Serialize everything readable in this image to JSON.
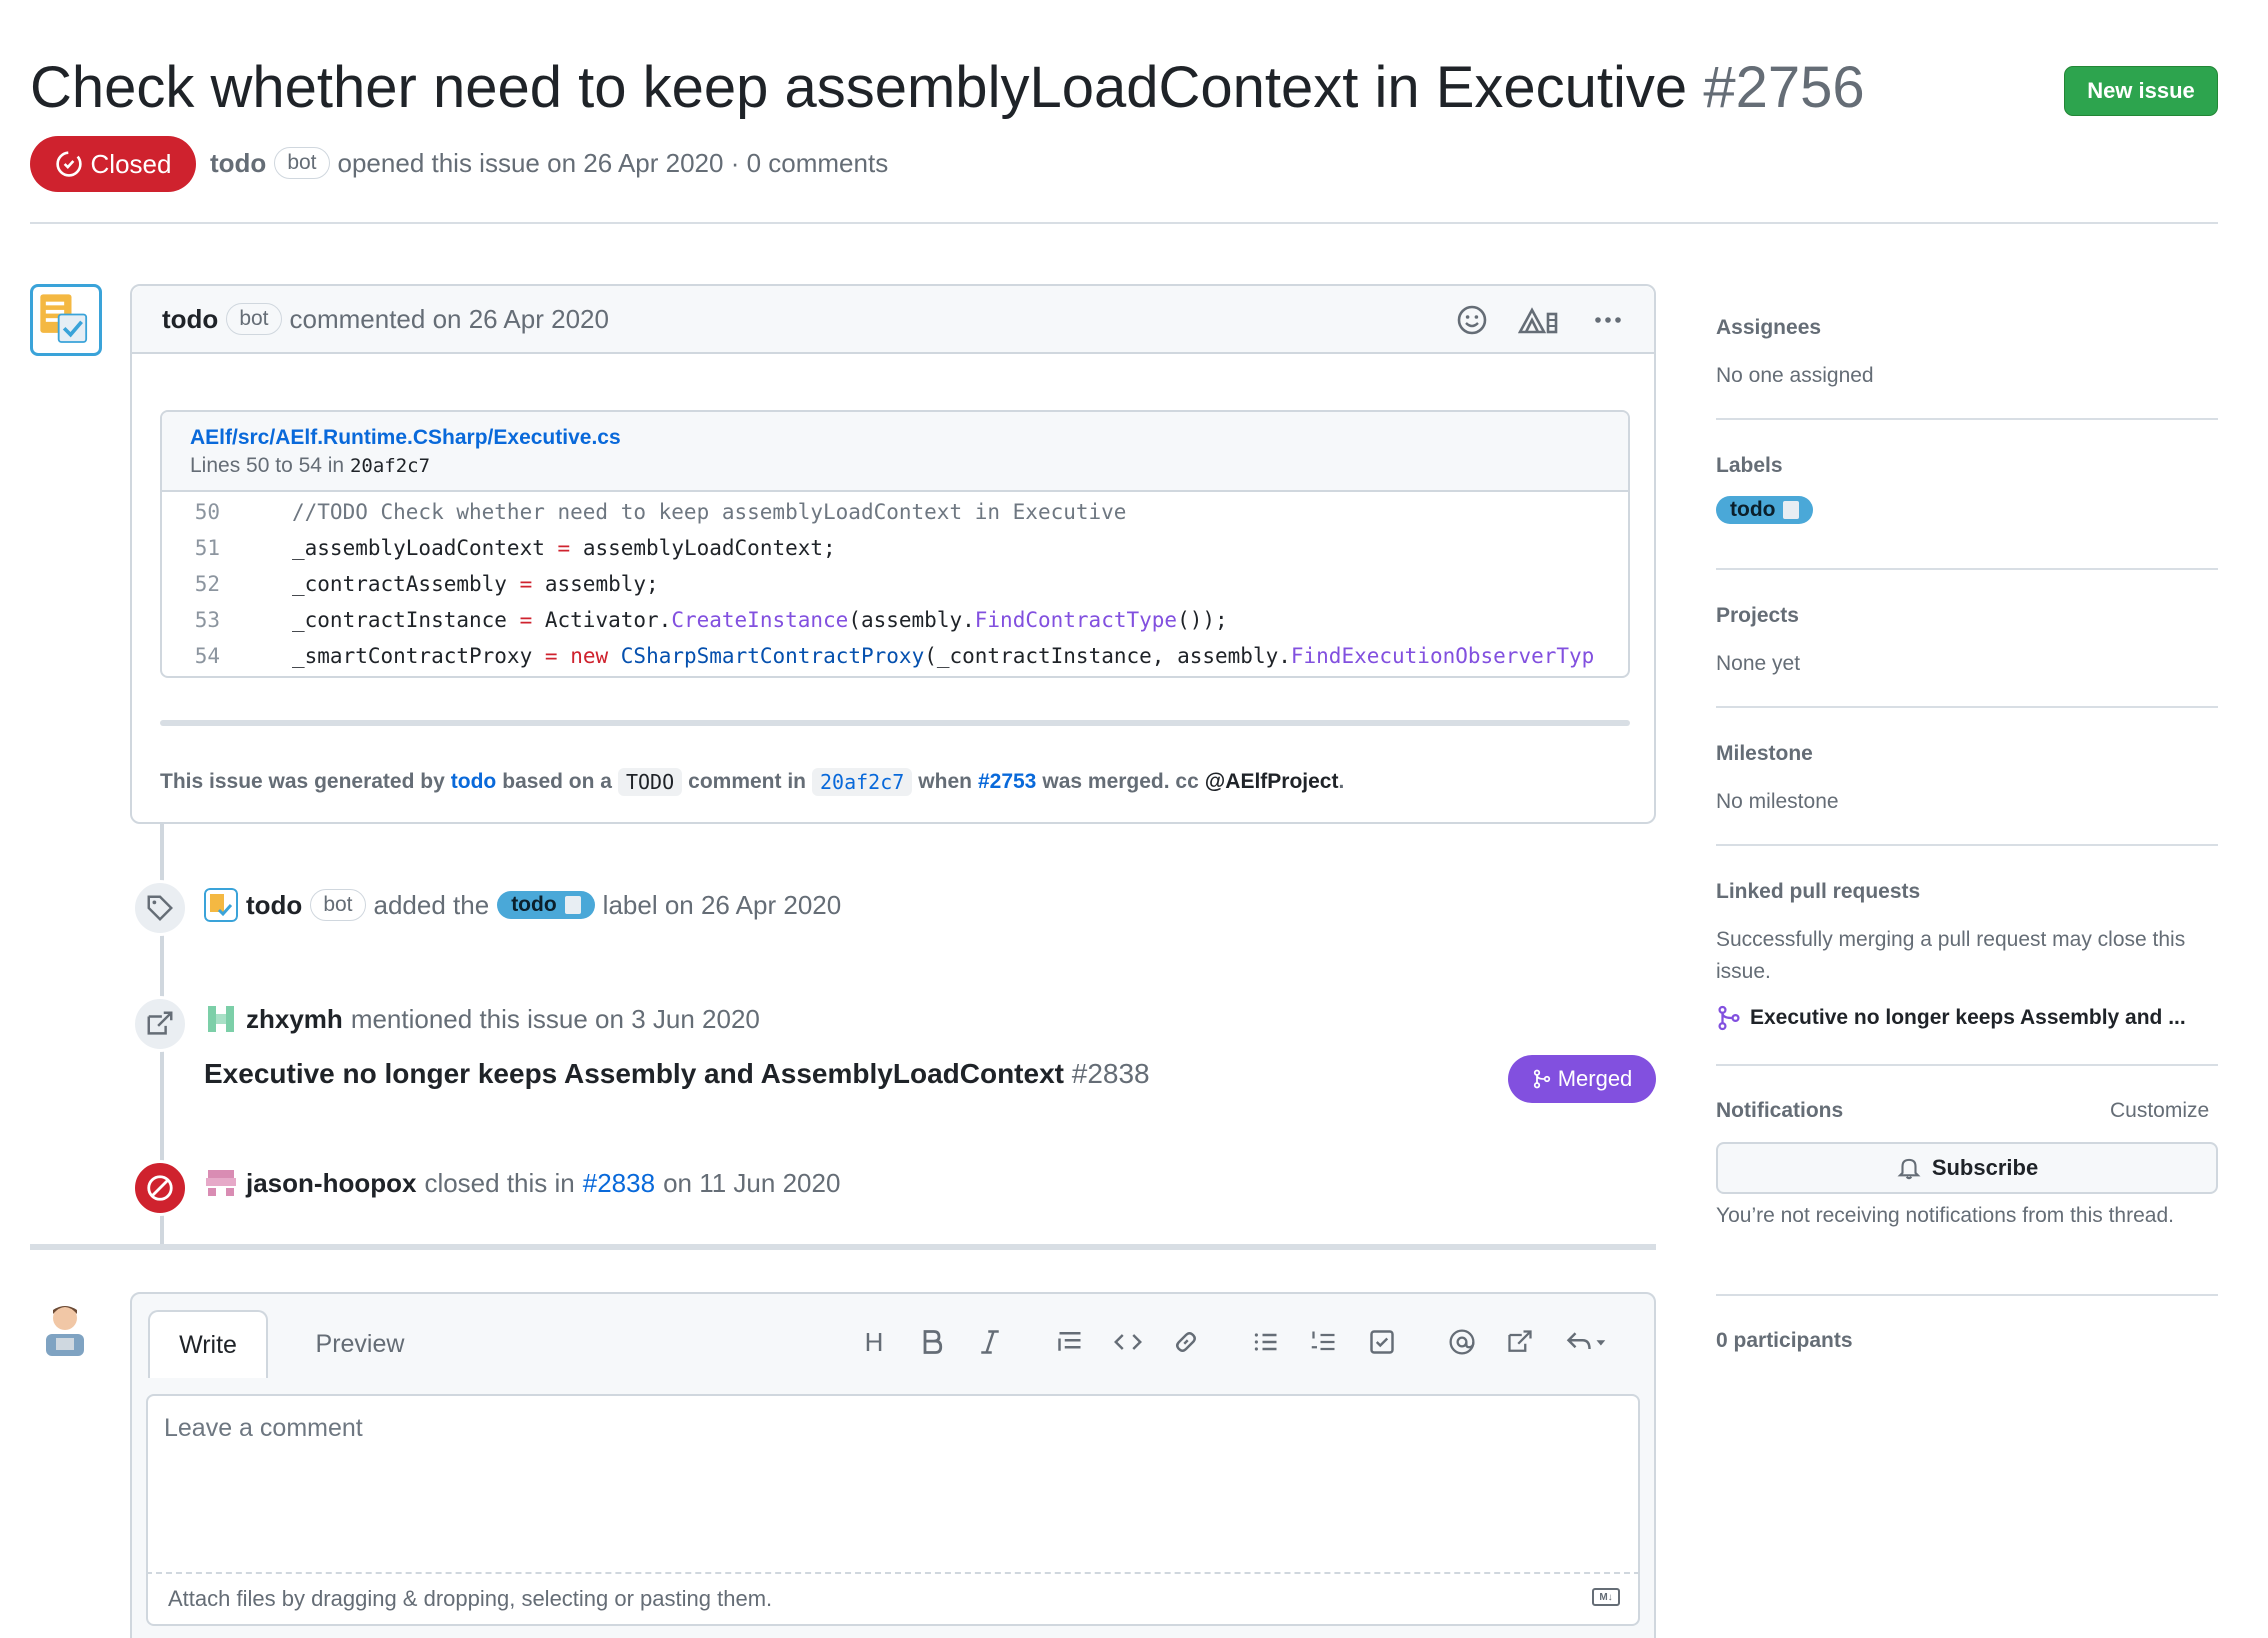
{
  "issue": {
    "title": "Check whether need to keep assemblyLoadContext in Executive",
    "number": "#2756",
    "state": "Closed",
    "author": "todo",
    "author_badge": "bot",
    "meta": "opened this issue on 26 Apr 2020 · 0 comments",
    "new_issue_label": "New issue"
  },
  "comment": {
    "author": "todo",
    "badge": "bot",
    "action": "commented on 26 Apr 2020",
    "file_path": "AElf/src/AElf.Runtime.CSharp/Executive.cs",
    "lines_prefix": "Lines 50 to 54 in",
    "commit": "20af2c7",
    "code": [
      {
        "n": "50",
        "text": "//TODO Check whether need to keep assemblyLoadContext in Executive"
      },
      {
        "n": "51",
        "text": "_assemblyLoadContext = assemblyLoadContext;"
      },
      {
        "n": "52",
        "text": "_contractAssembly = assembly;"
      },
      {
        "n": "53",
        "text": "_contractInstance = Activator.CreateInstance(assembly.FindContractType());"
      },
      {
        "n": "54",
        "text": "_smartContractProxy = new CSharpSmartContractProxy(_contractInstance, assembly.FindExecutionObserverTyp"
      }
    ],
    "note": {
      "p1": "This issue was generated by",
      "bot": "todo",
      "p2": "based on a",
      "todo": "TODO",
      "p3": "comment in",
      "commit": "20af2c7",
      "p4": "when",
      "pr": "#2753",
      "p5": "was merged. cc",
      "mention": "@AElfProject",
      "p6": "."
    }
  },
  "timeline": {
    "labeled": {
      "actor": "todo",
      "badge": "bot",
      "p1": "added the",
      "label": "todo",
      "p2": "label on 26 Apr 2020"
    },
    "mentioned": {
      "actor": "zhxymh",
      "text": "mentioned this issue on 3 Jun 2020",
      "pr_title": "Executive no longer keeps Assembly and AssemblyLoadContext",
      "pr_number": "#2838",
      "pr_state": "Merged"
    },
    "closed": {
      "actor": "jason-hoopox",
      "p1": "closed this in",
      "pr": "#2838",
      "p2": "on 11 Jun 2020"
    }
  },
  "compose": {
    "tab_write": "Write",
    "tab_preview": "Preview",
    "placeholder": "Leave a comment",
    "attach": "Attach files by dragging & dropping, selecting or pasting them.",
    "heading_icon": "H"
  },
  "sidebar": {
    "assignees_title": "Assignees",
    "assignees_value": "No one assigned",
    "labels_title": "Labels",
    "label": "todo",
    "projects_title": "Projects",
    "projects_value": "None yet",
    "milestone_title": "Milestone",
    "milestone_value": "No milestone",
    "linked_title": "Linked pull requests",
    "linked_text": "Successfully merging a pull request may close this issue.",
    "linked_pr": "Executive no longer keeps Assembly and ...",
    "notifications_title": "Notifications",
    "customize": "Customize",
    "subscribe": "Subscribe",
    "notify_text": "You’re not receiving notifications from this thread.",
    "participants": "0 participants"
  },
  "colors": {
    "closed": "#cf222e",
    "merged": "#8250df",
    "new_issue": "#2da44e",
    "label_todo": "#4aa8d8",
    "link": "#0969da"
  },
  "icons": [
    "issue-closed-icon",
    "smiley-icon",
    "triage-icon",
    "kebab-horizontal-icon",
    "tag-icon",
    "cross-reference-icon",
    "circle-slash-icon",
    "git-merge-icon",
    "bell-icon",
    "markdown-icon"
  ]
}
